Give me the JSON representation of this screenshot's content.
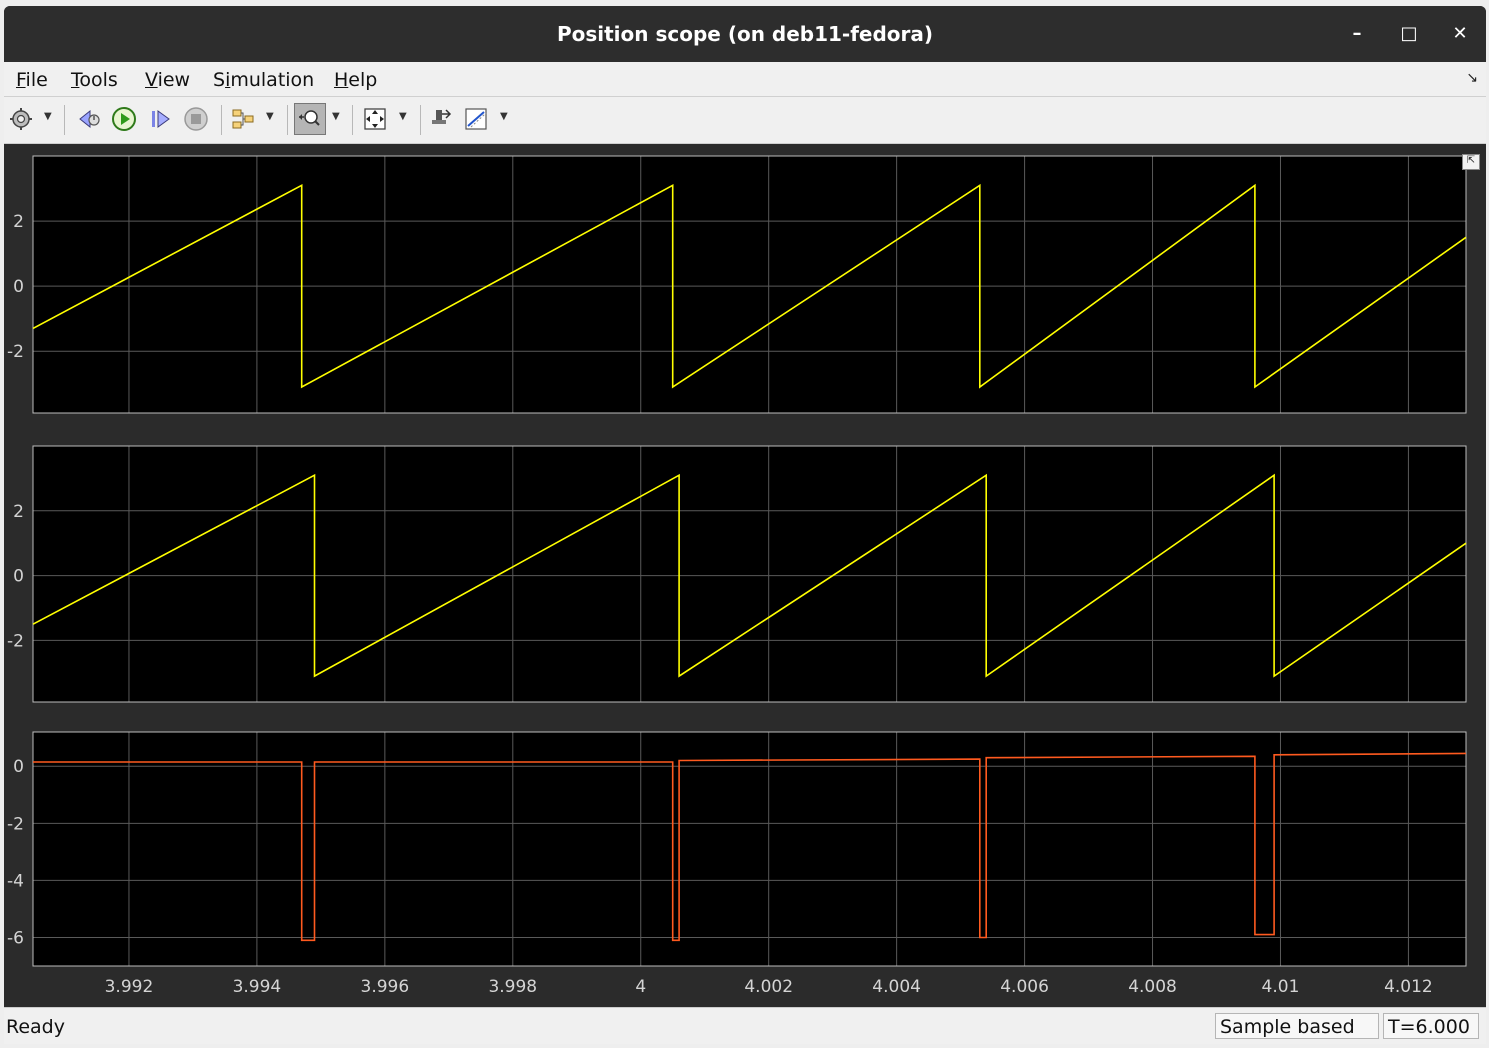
{
  "window": {
    "title": "Position scope (on deb11-fedora)"
  },
  "menu": {
    "items": [
      {
        "label": "File",
        "u": "F",
        "rest": "ile"
      },
      {
        "label": "Tools",
        "u": "T",
        "rest": "ools"
      },
      {
        "label": "View",
        "u": "V",
        "rest": "iew"
      },
      {
        "label": "Simulation",
        "pre": "S",
        "u": "i",
        "rest": "mulation"
      },
      {
        "label": "Help",
        "u": "H",
        "rest": "elp"
      }
    ]
  },
  "toolbar": {
    "icons": [
      "settings-icon",
      "step-back-icon",
      "run-icon",
      "step-forward-icon",
      "stop-icon",
      "signal-selector-icon",
      "zoom-x-icon",
      "autoscale-icon",
      "highlight-block-icon",
      "measurements-icon"
    ]
  },
  "status": {
    "ready": "Ready",
    "mode": "Sample based",
    "time": "T=6.000"
  },
  "colors": {
    "signal1": "#ffff00",
    "signal2": "#ffff00",
    "signal3": "#ff5a1f",
    "grid": "#5a5a5a",
    "axes_bg": "#000000",
    "figure_bg": "#2b2b2b",
    "tick": "#d4d4d4"
  },
  "chart_data": [
    {
      "type": "line",
      "xlim": [
        3.9905,
        4.0129
      ],
      "ylim": [
        -3.9,
        4.0
      ],
      "yticks": [
        "2",
        "0",
        "-2"
      ],
      "ytick_values": [
        2,
        0,
        -2
      ],
      "grid": true,
      "series": [
        {
          "color": "#ffff00",
          "x": [
            3.9905,
            3.9947,
            3.9947,
            4.0005,
            4.0005,
            4.0053,
            4.0053,
            4.0096,
            4.0096,
            4.0129
          ],
          "y": [
            -1.3,
            3.1,
            -3.1,
            3.1,
            -3.1,
            3.1,
            -3.1,
            3.1,
            -3.1,
            1.5
          ]
        }
      ]
    },
    {
      "type": "line",
      "xlim": [
        3.9905,
        4.0129
      ],
      "ylim": [
        -3.9,
        4.0
      ],
      "yticks": [
        "2",
        "0",
        "-2"
      ],
      "ytick_values": [
        2,
        0,
        -2
      ],
      "grid": true,
      "series": [
        {
          "color": "#ffff00",
          "x": [
            3.9905,
            3.9949,
            3.9949,
            4.0006,
            4.0006,
            4.0054,
            4.0054,
            4.0099,
            4.0099,
            4.0129
          ],
          "y": [
            -1.5,
            3.1,
            -3.1,
            3.1,
            -3.1,
            3.1,
            -3.1,
            3.1,
            -3.1,
            1.0
          ]
        }
      ]
    },
    {
      "type": "line",
      "xlim": [
        3.9905,
        4.0129
      ],
      "ylim": [
        -7.0,
        1.2
      ],
      "yticks": [
        "0",
        "-2",
        "-4",
        "-6"
      ],
      "ytick_values": [
        0,
        -2,
        -4,
        -6
      ],
      "xticks": [
        "3.992",
        "3.994",
        "3.996",
        "3.998",
        "4",
        "4.002",
        "4.004",
        "4.006",
        "4.008",
        "4.01",
        "4.012"
      ],
      "xtick_values": [
        3.992,
        3.994,
        3.996,
        3.998,
        4.0,
        4.002,
        4.004,
        4.006,
        4.008,
        4.01,
        4.012
      ],
      "grid": true,
      "series": [
        {
          "color": "#ff5a1f",
          "x": [
            3.9905,
            3.9947,
            3.9947,
            3.9949,
            3.9949,
            4.0005,
            4.0005,
            4.0006,
            4.0006,
            4.0053,
            4.0053,
            4.0054,
            4.0054,
            4.0096,
            4.0096,
            4.0099,
            4.0099,
            4.0129
          ],
          "y": [
            0.15,
            0.15,
            -6.1,
            -6.1,
            0.15,
            0.15,
            -6.1,
            -6.1,
            0.2,
            0.25,
            -6.0,
            -6.0,
            0.3,
            0.35,
            -5.9,
            -5.9,
            0.4,
            0.45
          ]
        }
      ]
    }
  ]
}
